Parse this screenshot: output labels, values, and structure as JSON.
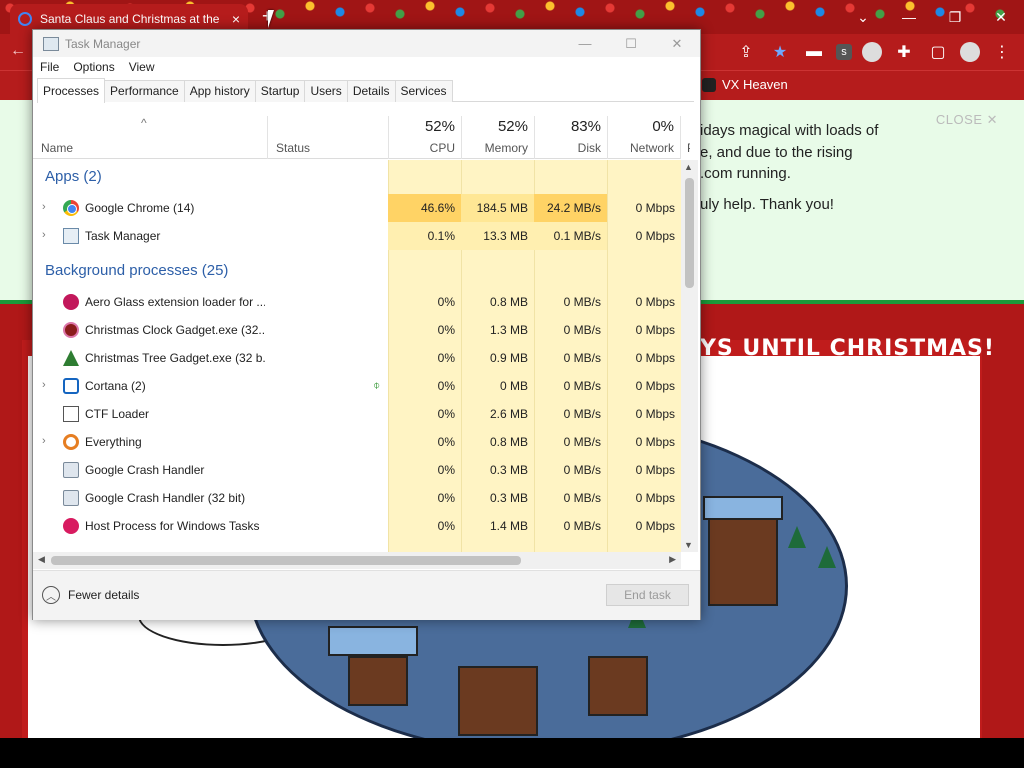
{
  "browser": {
    "tab_title": "Santa Claus and Christmas at the",
    "tab_close": "×",
    "newtab": "+",
    "window_controls": [
      "⌄",
      "—",
      "❐",
      "✕"
    ],
    "back_icon": "←",
    "bookmark_label": "VX Heaven"
  },
  "page": {
    "notice_lines": [
      "idays magical with loads of",
      "e, and due to the rising",
      ".com running.",
      "uly help. Thank you!"
    ],
    "notice_close": "CLOSE ✕",
    "countdown_title": "YS UNTIL CHRISTMAS!"
  },
  "taskmanager": {
    "title": "Task Manager",
    "controls": [
      "—",
      "☐",
      "✕"
    ],
    "menu": [
      "File",
      "Options",
      "View"
    ],
    "tabs": [
      "Processes",
      "Performance",
      "App history",
      "Startup",
      "Users",
      "Details",
      "Services"
    ],
    "active_tab": "Processes",
    "header": {
      "sort_arrow": "^",
      "name": "Name",
      "status": "Status",
      "cpu_pct": "52%",
      "cpu": "CPU",
      "mem_pct": "52%",
      "mem": "Memory",
      "disk_pct": "83%",
      "disk": "Disk",
      "net_pct": "0%",
      "net": "Network",
      "power": "P"
    },
    "groups": {
      "apps": "Apps (2)",
      "background": "Background processes (25)"
    },
    "apps": [
      {
        "name": "Google Chrome (14)",
        "cpu": "46.6%",
        "mem": "184.5 MB",
        "disk": "24.2 MB/s",
        "net": "0 Mbps",
        "icon": "chrome-icon"
      },
      {
        "name": "Task Manager",
        "cpu": "0.1%",
        "mem": "13.3 MB",
        "disk": "0.1 MB/s",
        "net": "0 Mbps",
        "icon": "task-manager-icon"
      }
    ],
    "background": [
      {
        "name": "Aero Glass extension loader for ...",
        "cpu": "0%",
        "mem": "0.8 MB",
        "disk": "0 MB/s",
        "net": "0 Mbps",
        "icon": "aero-glass-icon"
      },
      {
        "name": "Christmas Clock Gadget.exe (32...",
        "cpu": "0%",
        "mem": "1.3 MB",
        "disk": "0 MB/s",
        "net": "0 Mbps",
        "icon": "clock-gadget-icon"
      },
      {
        "name": "Christmas Tree Gadget.exe (32 b...",
        "cpu": "0%",
        "mem": "0.9 MB",
        "disk": "0 MB/s",
        "net": "0 Mbps",
        "icon": "tree-gadget-icon"
      },
      {
        "name": "Cortana (2)",
        "cpu": "0%",
        "mem": "0 MB",
        "disk": "0 MB/s",
        "net": "0 Mbps",
        "icon": "cortana-icon"
      },
      {
        "name": "CTF Loader",
        "cpu": "0%",
        "mem": "2.6 MB",
        "disk": "0 MB/s",
        "net": "0 Mbps",
        "icon": "ctf-loader-icon"
      },
      {
        "name": "Everything",
        "cpu": "0%",
        "mem": "0.8 MB",
        "disk": "0 MB/s",
        "net": "0 Mbps",
        "icon": "everything-icon"
      },
      {
        "name": "Google Crash Handler",
        "cpu": "0%",
        "mem": "0.3 MB",
        "disk": "0 MB/s",
        "net": "0 Mbps",
        "icon": "crash-handler-icon"
      },
      {
        "name": "Google Crash Handler (32 bit)",
        "cpu": "0%",
        "mem": "0.3 MB",
        "disk": "0 MB/s",
        "net": "0 Mbps",
        "icon": "crash-handler-icon"
      },
      {
        "name": "Host Process for Windows Tasks",
        "cpu": "0%",
        "mem": "1.4 MB",
        "disk": "0 MB/s",
        "net": "0 Mbps",
        "icon": "host-process-icon"
      }
    ],
    "footer": {
      "fewer_details": "Fewer details",
      "end_task": "End task"
    }
  }
}
